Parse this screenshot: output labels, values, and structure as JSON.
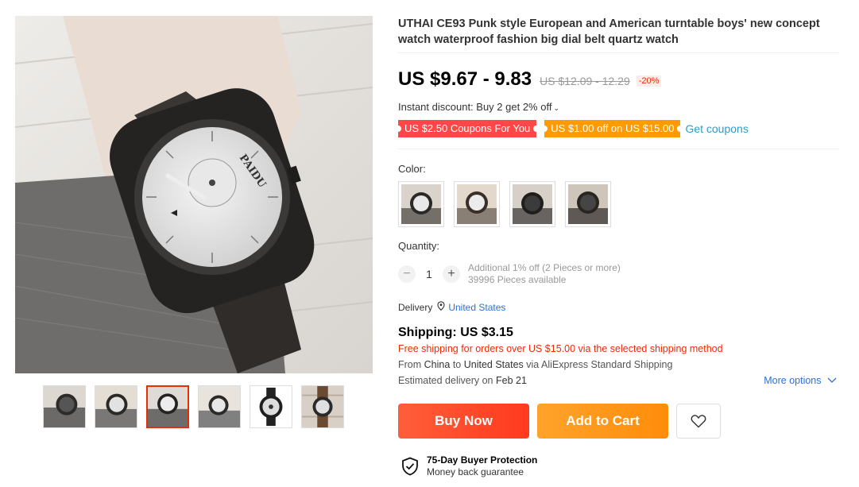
{
  "product": {
    "title": "UTHAI CE93 Punk style European and American turntable boys' new concept watch waterproof fashion big dial belt quartz watch",
    "price": "US $9.67 - 9.83",
    "original_price": "US $12.09 - 12.29",
    "discount": "-20%",
    "instant_discount": "Instant discount: Buy 2 get 2% off",
    "watch_brand_on_dial": "PAIDU"
  },
  "coupons": {
    "items": [
      {
        "label": "US $2.50 Coupons For You",
        "color": "#ff4747"
      },
      {
        "label": "US $1.00 off on US $15.00",
        "color": "#ff9a00"
      }
    ],
    "get_label": "Get coupons"
  },
  "color": {
    "label": "Color:",
    "options": [
      "white-dial",
      "white-dial-brown-strap",
      "black-dial",
      "black-dial-leather"
    ]
  },
  "quantity": {
    "label": "Quantity:",
    "minus": "−",
    "value": "1",
    "plus": "+",
    "additional": "Additional 1% off (2 Pieces or more)",
    "available": "39996 Pieces available"
  },
  "delivery": {
    "label": "Delivery",
    "country": "United States"
  },
  "shipping": {
    "title": "Shipping: US $3.15",
    "free_note": "Free shipping for orders over US $15.00 via the selected shipping method",
    "from_prefix": "From",
    "from_country": "China",
    "to_word": "to",
    "to_country": "United States",
    "via": "via AliExpress Standard Shipping",
    "est_prefix": "Estimated delivery on",
    "est_date": "Feb 21",
    "more_options": "More options"
  },
  "actions": {
    "buy_now": "Buy Now",
    "add_to_cart": "Add to Cart",
    "wishlist_icon": "heart-icon"
  },
  "protection": {
    "title": "75-Day Buyer Protection",
    "subtitle": "Money back guarantee"
  },
  "gallery": {
    "thumbnails": [
      "wrist-dark",
      "wrist-white-dial",
      "wrist-white-dial-selected",
      "wrist-angle",
      "product-front",
      "wrist-wood"
    ],
    "active_index": 2
  },
  "colors": {
    "accent_red": "#e62e04",
    "buy_now": "#ff4a26",
    "add_to_cart": "#ff9a15",
    "link_blue": "#2e6fd6"
  }
}
